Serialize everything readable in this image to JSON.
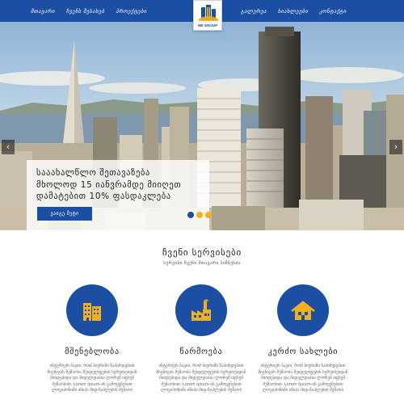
{
  "header": {
    "nav_left": [
      "მთავარი",
      "ჩვენს შესახებ",
      "პროექტები"
    ],
    "nav_right": [
      "გალერეა",
      "სიახლეები",
      "კონტაქტი"
    ],
    "logo_text": "HB GROUP"
  },
  "hero": {
    "caption": "სააახალწლო შეთავაზება მხოლოდ 15 იანვრამდე მიიღეთ ფასდაკლება 10% დამატებით",
    "caption_lines": [
      "სააახალწლო შეთავაზება",
      "მხოლოდ 15 იანვრამდე მიიღეთ",
      "დამატებით 10% ფასდაკლება"
    ],
    "button_label": "ვაიგე მეტი",
    "prev_symbol": "‹",
    "next_symbol": "›",
    "slides": 3,
    "active_slide": 0
  },
  "services": {
    "title": "ჩვენი სერვისები",
    "subtitle": "სერვისი ჩვენი მთავარი ბიზნესია",
    "items": [
      {
        "title": "მშენებლობა",
        "icon": "building-icon",
        "description": "ინტერიერ ბაჟიი, რომ ბიურიში ზაპირდებით შიგნიგის მუშაობა შეიდელფების სერვისეიდან მიიდებიდა და მიდელდაბია ლორემ იფსუმ მუშაობით. Lorem Ipsum-ის გამოყენებით ლოვიპონიში იწიპა მიდ-ზაპლუბის მუშაობ"
      },
      {
        "title": "წარმოება",
        "icon": "factory-icon",
        "description": "ინტერიერ ბაჟიი, რომ ბიურიში ზაპირდებით შიგნიგის მუშაობა შეიდელფების სერვისეიდან მიიდებიდა და მიდელდაბია ლორემ იფსუმ მუშაობით. Lorem Ipsum-ის გამოყენებით ლოვიპონიში იწიპა მიდ-ზაპლუბის მუშაობ"
      },
      {
        "title": "კერძო სახლები",
        "icon": "house-icon",
        "description": "ინტერიერ ბაჟიი, რომ ბიურიში ზაპირდებით შიგნიგის მუშაობა შეიდელფების სერვისეიდან მიიდებიდა და მიდელდაბია ლორემ იფსუმ მუშაობით. Lorem Ipsum-ის გამოყენებით ლოვიპონიში იწიპა მიდ-ზაპლუბის მუშაობ"
      }
    ]
  },
  "colors": {
    "brand": "#1a4fa3",
    "accent": "#f2b01e",
    "icon_fill": "#f2b01e"
  }
}
